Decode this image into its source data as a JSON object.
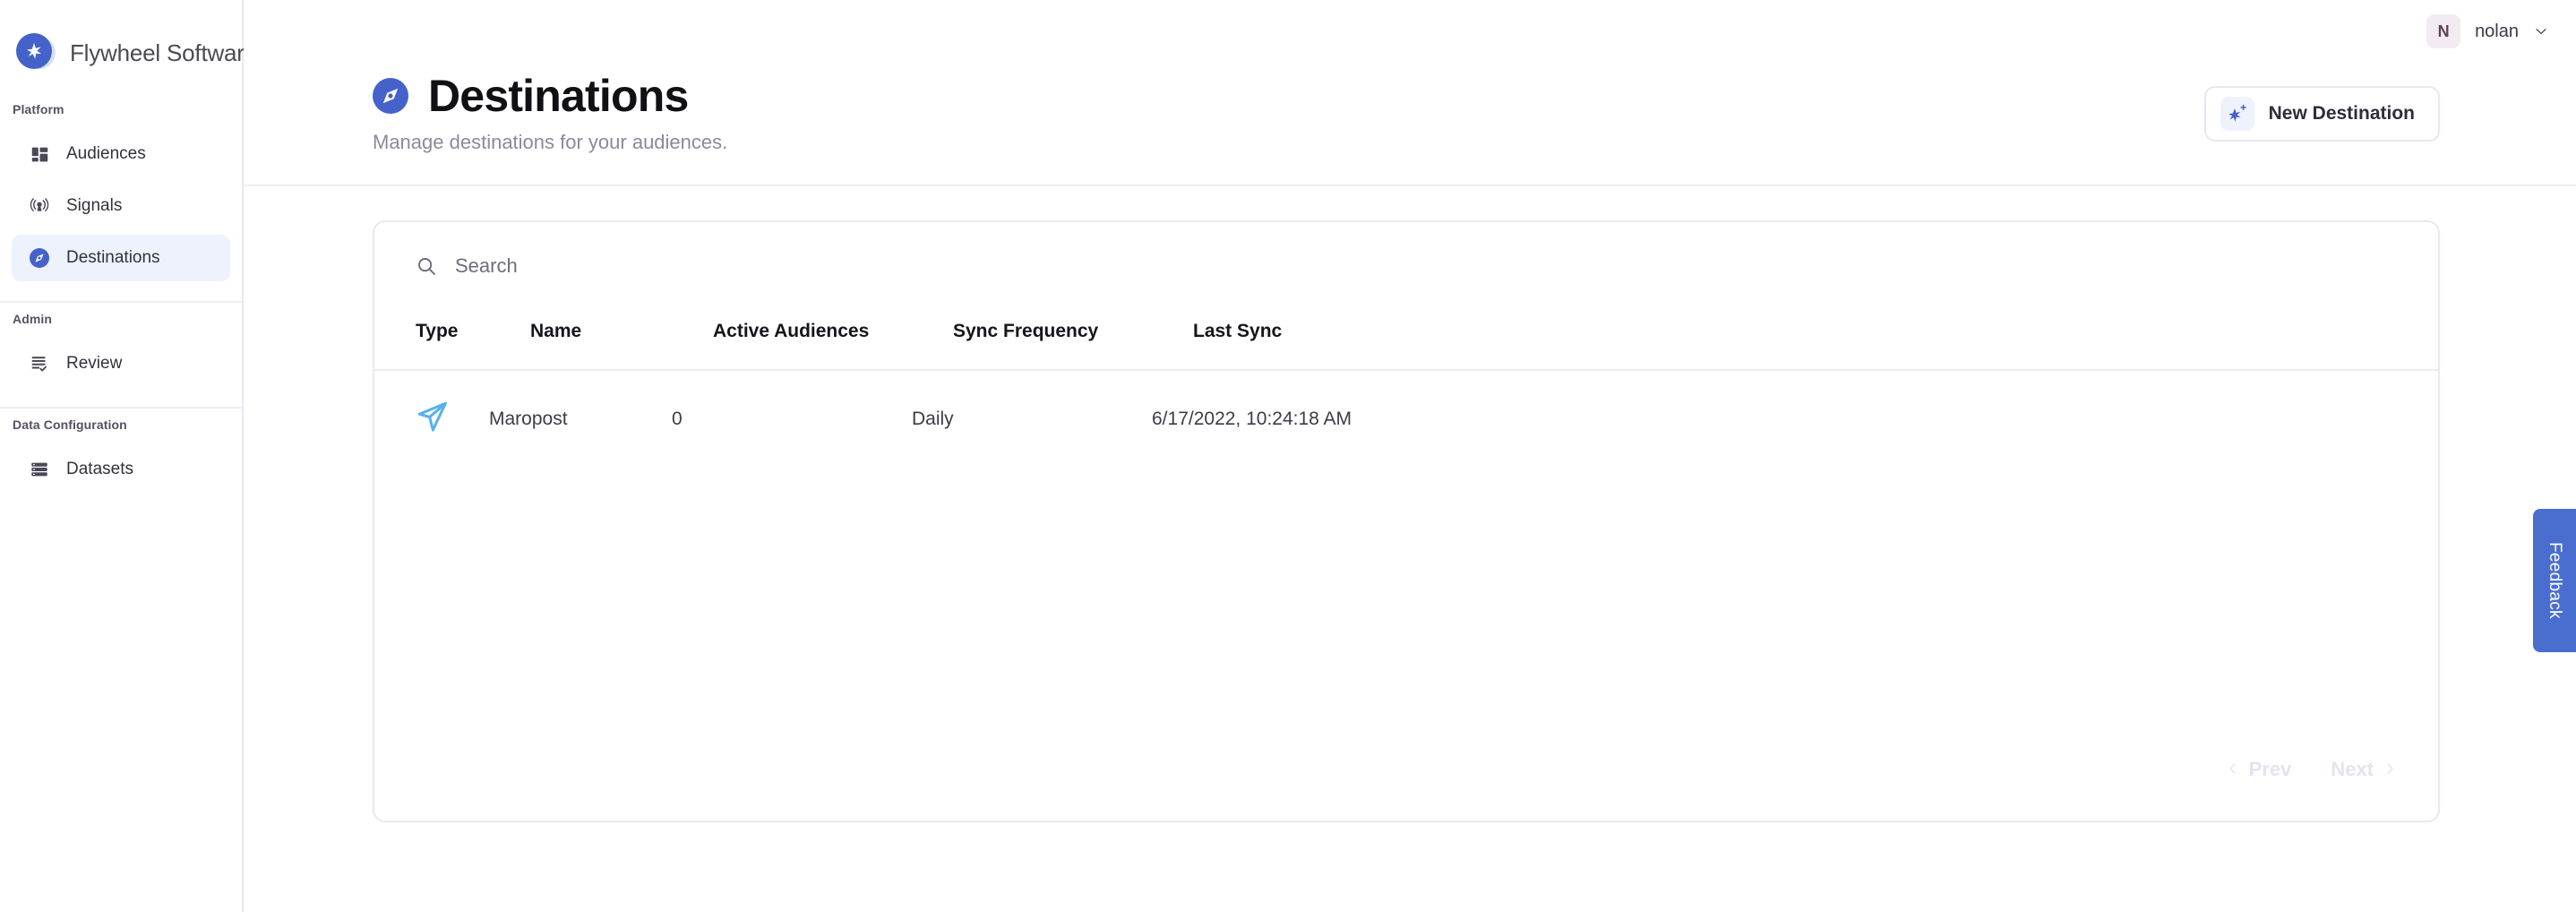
{
  "brand": {
    "name": "Flywheel Software",
    "logo_icon": "sparkle-icon",
    "logo_color": "#4462c9"
  },
  "topbar": {
    "user": {
      "avatar_initial": "N",
      "name": "nolan",
      "chevron_icon": "chevron-down-icon"
    }
  },
  "sidebar": {
    "groups": [
      {
        "label": "Platform",
        "items": [
          {
            "label": "Audiences",
            "icon": "dashboard-grid-icon",
            "active": false
          },
          {
            "label": "Signals",
            "icon": "broadcast-icon",
            "active": false
          },
          {
            "label": "Destinations",
            "icon": "compass-icon",
            "active": true
          }
        ]
      },
      {
        "label": "Admin",
        "items": [
          {
            "label": "Review",
            "icon": "list-check-icon",
            "active": false
          }
        ]
      },
      {
        "label": "Data Configuration",
        "items": [
          {
            "label": "Datasets",
            "icon": "database-icon",
            "active": false
          }
        ]
      }
    ]
  },
  "page": {
    "icon": "compass-icon",
    "title": "Destinations",
    "subtitle": "Manage destinations for your audiences.",
    "new_button": {
      "label": "New Destination",
      "icon": "sparkle-plus-icon"
    }
  },
  "search": {
    "icon": "search-icon",
    "placeholder": "Search",
    "value": ""
  },
  "table": {
    "columns": [
      "Type",
      "Name",
      "Active Audiences",
      "Sync Frequency",
      "Last Sync"
    ],
    "rows": [
      {
        "type_icon": "paper-plane-icon",
        "type_icon_color": "#55b0ef",
        "name": "Maropost",
        "active_audiences": "0",
        "sync_frequency": "Daily",
        "last_sync": "6/17/2022, 10:24:18 AM"
      }
    ]
  },
  "pagination": {
    "prev_label": "Prev",
    "next_label": "Next",
    "prev_icon": "chevron-left-icon",
    "next_icon": "chevron-right-icon",
    "prev_disabled": true,
    "next_disabled": true
  },
  "feedback": {
    "label": "Feedback",
    "color": "#4a6ed0"
  }
}
